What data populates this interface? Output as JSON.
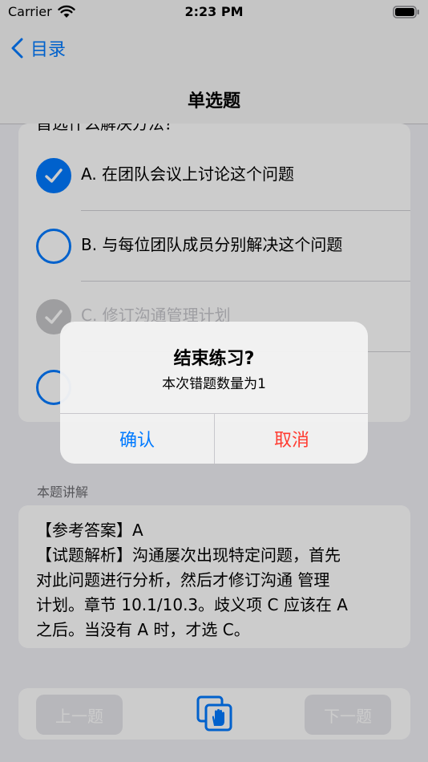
{
  "status_bar": {
    "carrier": "Carrier",
    "time": "2:23 PM"
  },
  "nav": {
    "back_label": "目录",
    "title": "单选题"
  },
  "question": {
    "stem_partial": "首选什么解决方法？",
    "options": [
      {
        "label": "A. 在团队会议上讨论这个问题",
        "state": "selected"
      },
      {
        "label": "B. 与每位团队成员分别解决这个问题",
        "state": "unselected"
      },
      {
        "label": "C. 修订沟通管理计划",
        "state": "disabled"
      },
      {
        "label": "",
        "state": "unselected"
      }
    ]
  },
  "explanation": {
    "header": "本题讲解",
    "text": "【参考答案】A\n【试题解析】沟通屡次出现特定问题，首先\n对此问题进行分析，然后才修订沟通 管理\n计划。章节 10.1/10.3。歧义项 C 应该在 A\n之后。当没有 A 时，才选 C。"
  },
  "toolbar": {
    "prev_label": "上一题",
    "next_label": "下一题",
    "center_icon": "answer-sheet-icon"
  },
  "alert": {
    "title": "结束练习?",
    "message": "本次错题数量为1",
    "confirm_label": "确认",
    "cancel_label": "取消"
  },
  "colors": {
    "accent": "#007aff",
    "destructive": "#ff3b30",
    "background": "#efeff4"
  }
}
